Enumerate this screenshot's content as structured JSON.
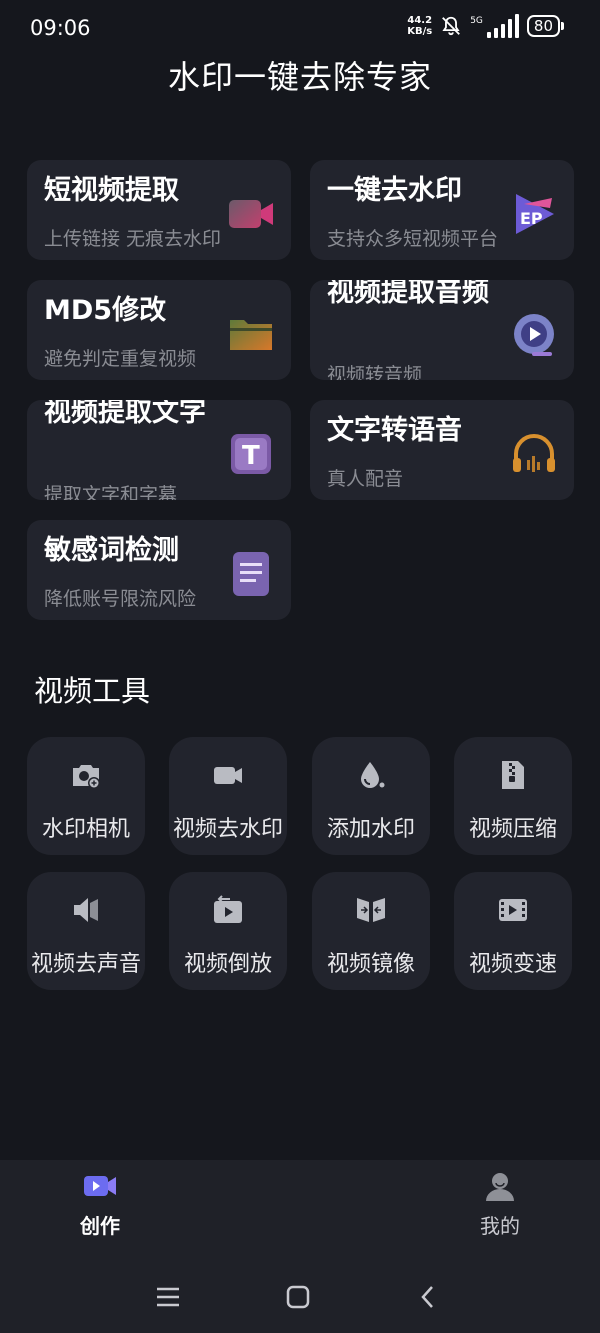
{
  "status": {
    "time": "09:06",
    "net_speed_value": "44.2",
    "net_speed_unit": "KB/s",
    "network": "5G",
    "battery": "80"
  },
  "app": {
    "title": "水印一键去除专家"
  },
  "features": [
    {
      "title": "短视频提取",
      "subtitle": "上传链接 无痕去水印",
      "icon": "video-camera-icon"
    },
    {
      "title": "一键去水印",
      "subtitle": "支持众多短视频平台",
      "icon": "ep-play-icon"
    },
    {
      "title": "MD5修改",
      "subtitle": "避免判定重复视频",
      "icon": "folder-icon"
    },
    {
      "title": "视频提取音频",
      "subtitle": "视频转音频",
      "icon": "audio-play-icon"
    },
    {
      "title": "视频提取文字",
      "subtitle": "提取文字和字幕",
      "icon": "text-t-icon"
    },
    {
      "title": "文字转语音",
      "subtitle": "真人配音",
      "icon": "headphones-icon"
    },
    {
      "title": "敏感词检测",
      "subtitle": "降低账号限流风险",
      "icon": "document-icon"
    }
  ],
  "tools_section": {
    "title": "视频工具"
  },
  "tools": [
    {
      "label": "水印相机",
      "icon": "camera-add-icon"
    },
    {
      "label": "视频去水印",
      "icon": "video-icon"
    },
    {
      "label": "添加水印",
      "icon": "droplet-icon"
    },
    {
      "label": "视频压缩",
      "icon": "zip-file-icon"
    },
    {
      "label": "视频去声音",
      "icon": "mute-speaker-icon"
    },
    {
      "label": "视频倒放",
      "icon": "reverse-play-icon"
    },
    {
      "label": "视频镜像",
      "icon": "mirror-icon"
    },
    {
      "label": "视频变速",
      "icon": "film-speed-icon"
    }
  ],
  "bottom_nav": {
    "create_label": "创作",
    "mine_label": "我的"
  },
  "colors": {
    "background": "#15171d",
    "card": "#22242d",
    "accent": "#6c6cf0",
    "subtitle": "#8a8c93"
  }
}
